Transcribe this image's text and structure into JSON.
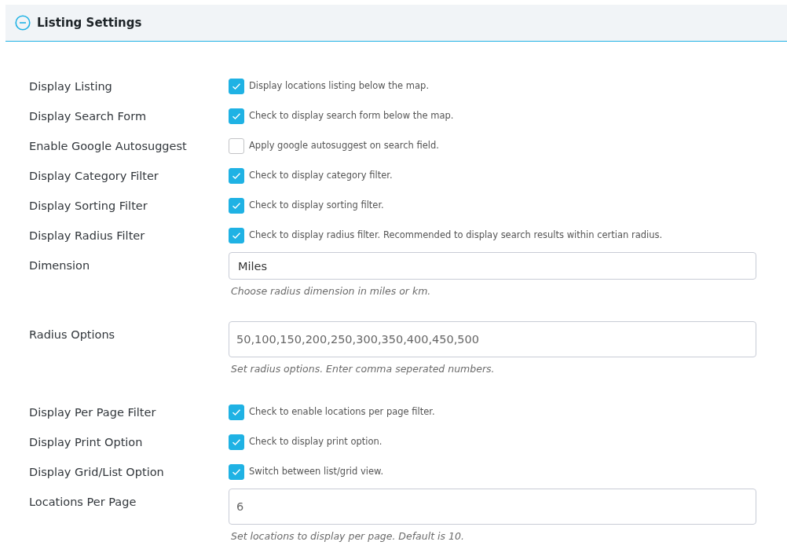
{
  "panel": {
    "title": "Listing Settings",
    "expanded": true
  },
  "rows": [
    {
      "kind": "checkbox",
      "label": "Display Listing",
      "checked": true,
      "description": "Display locations listing below the map."
    },
    {
      "kind": "checkbox",
      "label": "Display Search Form",
      "checked": true,
      "description": "Check to display search form below the map."
    },
    {
      "kind": "checkbox",
      "label": "Enable Google Autosuggest",
      "checked": false,
      "description": "Apply google autosuggest on search field."
    },
    {
      "kind": "checkbox",
      "label": "Display Category Filter",
      "checked": true,
      "description": "Check to display category filter."
    },
    {
      "kind": "checkbox",
      "label": "Display Sorting Filter",
      "checked": true,
      "description": "Check to display sorting filter."
    },
    {
      "kind": "checkbox",
      "label": "Display Radius Filter",
      "checked": true,
      "description": "Check to display radius filter. Recommended to display search results within certian radius."
    },
    {
      "kind": "select",
      "label": "Dimension",
      "value": "Miles",
      "help": "Choose radius dimension in miles or km."
    },
    {
      "kind": "text",
      "label": "Radius Options",
      "value": "50,100,150,200,250,300,350,400,450,500",
      "help": "Set radius options. Enter comma seperated numbers."
    },
    {
      "kind": "checkbox",
      "label": "Display Per Page Filter",
      "checked": true,
      "description": "Check to enable locations per page filter."
    },
    {
      "kind": "checkbox",
      "label": "Display Print Option",
      "checked": true,
      "description": "Check to display print option."
    },
    {
      "kind": "checkbox",
      "label": "Display Grid/List Option",
      "checked": true,
      "description": "Switch between list/grid view."
    },
    {
      "kind": "text",
      "label": "Locations Per Page",
      "value": "6",
      "help": "Set locations to display per page. Default is 10."
    }
  ]
}
